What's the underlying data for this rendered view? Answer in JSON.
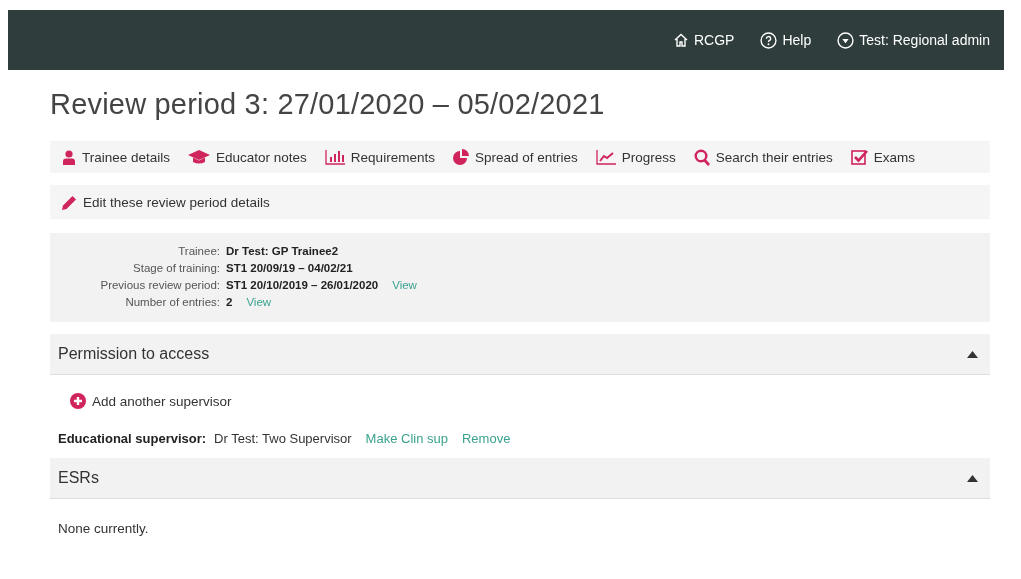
{
  "header": {
    "links": [
      {
        "label": "RCGP"
      },
      {
        "label": "Help"
      },
      {
        "label": "Test: Regional admin"
      }
    ]
  },
  "title": "Review period 3: 27/01/2020 – 05/02/2021",
  "nav": [
    {
      "label": "Trainee details"
    },
    {
      "label": "Educator notes"
    },
    {
      "label": "Requirements"
    },
    {
      "label": "Spread of entries"
    },
    {
      "label": "Progress"
    },
    {
      "label": "Search their entries"
    },
    {
      "label": "Exams"
    }
  ],
  "edit_link": "Edit these review period details",
  "info": [
    {
      "label": "Trainee:",
      "value": "Dr Test: GP Trainee2"
    },
    {
      "label": "Stage of training:",
      "value": "ST1 20/09/19 – 04/02/21"
    },
    {
      "label": "Previous review period:",
      "value": "ST1 20/10/2019 – 26/01/2020",
      "link": "View"
    },
    {
      "label": "Number of entries:",
      "value": "2",
      "link": "View"
    }
  ],
  "sections": [
    {
      "title": "Permission to access",
      "expanded": true,
      "add_link": "Add another supervisor",
      "supervisors": [
        {
          "role": "Educational supervisor:",
          "name": "Dr Test: Two Supervisor",
          "actions": [
            "Make Clin sup",
            "Remove"
          ]
        }
      ]
    },
    {
      "title": "ESRs",
      "expanded": true,
      "empty_text": "None currently."
    }
  ]
}
